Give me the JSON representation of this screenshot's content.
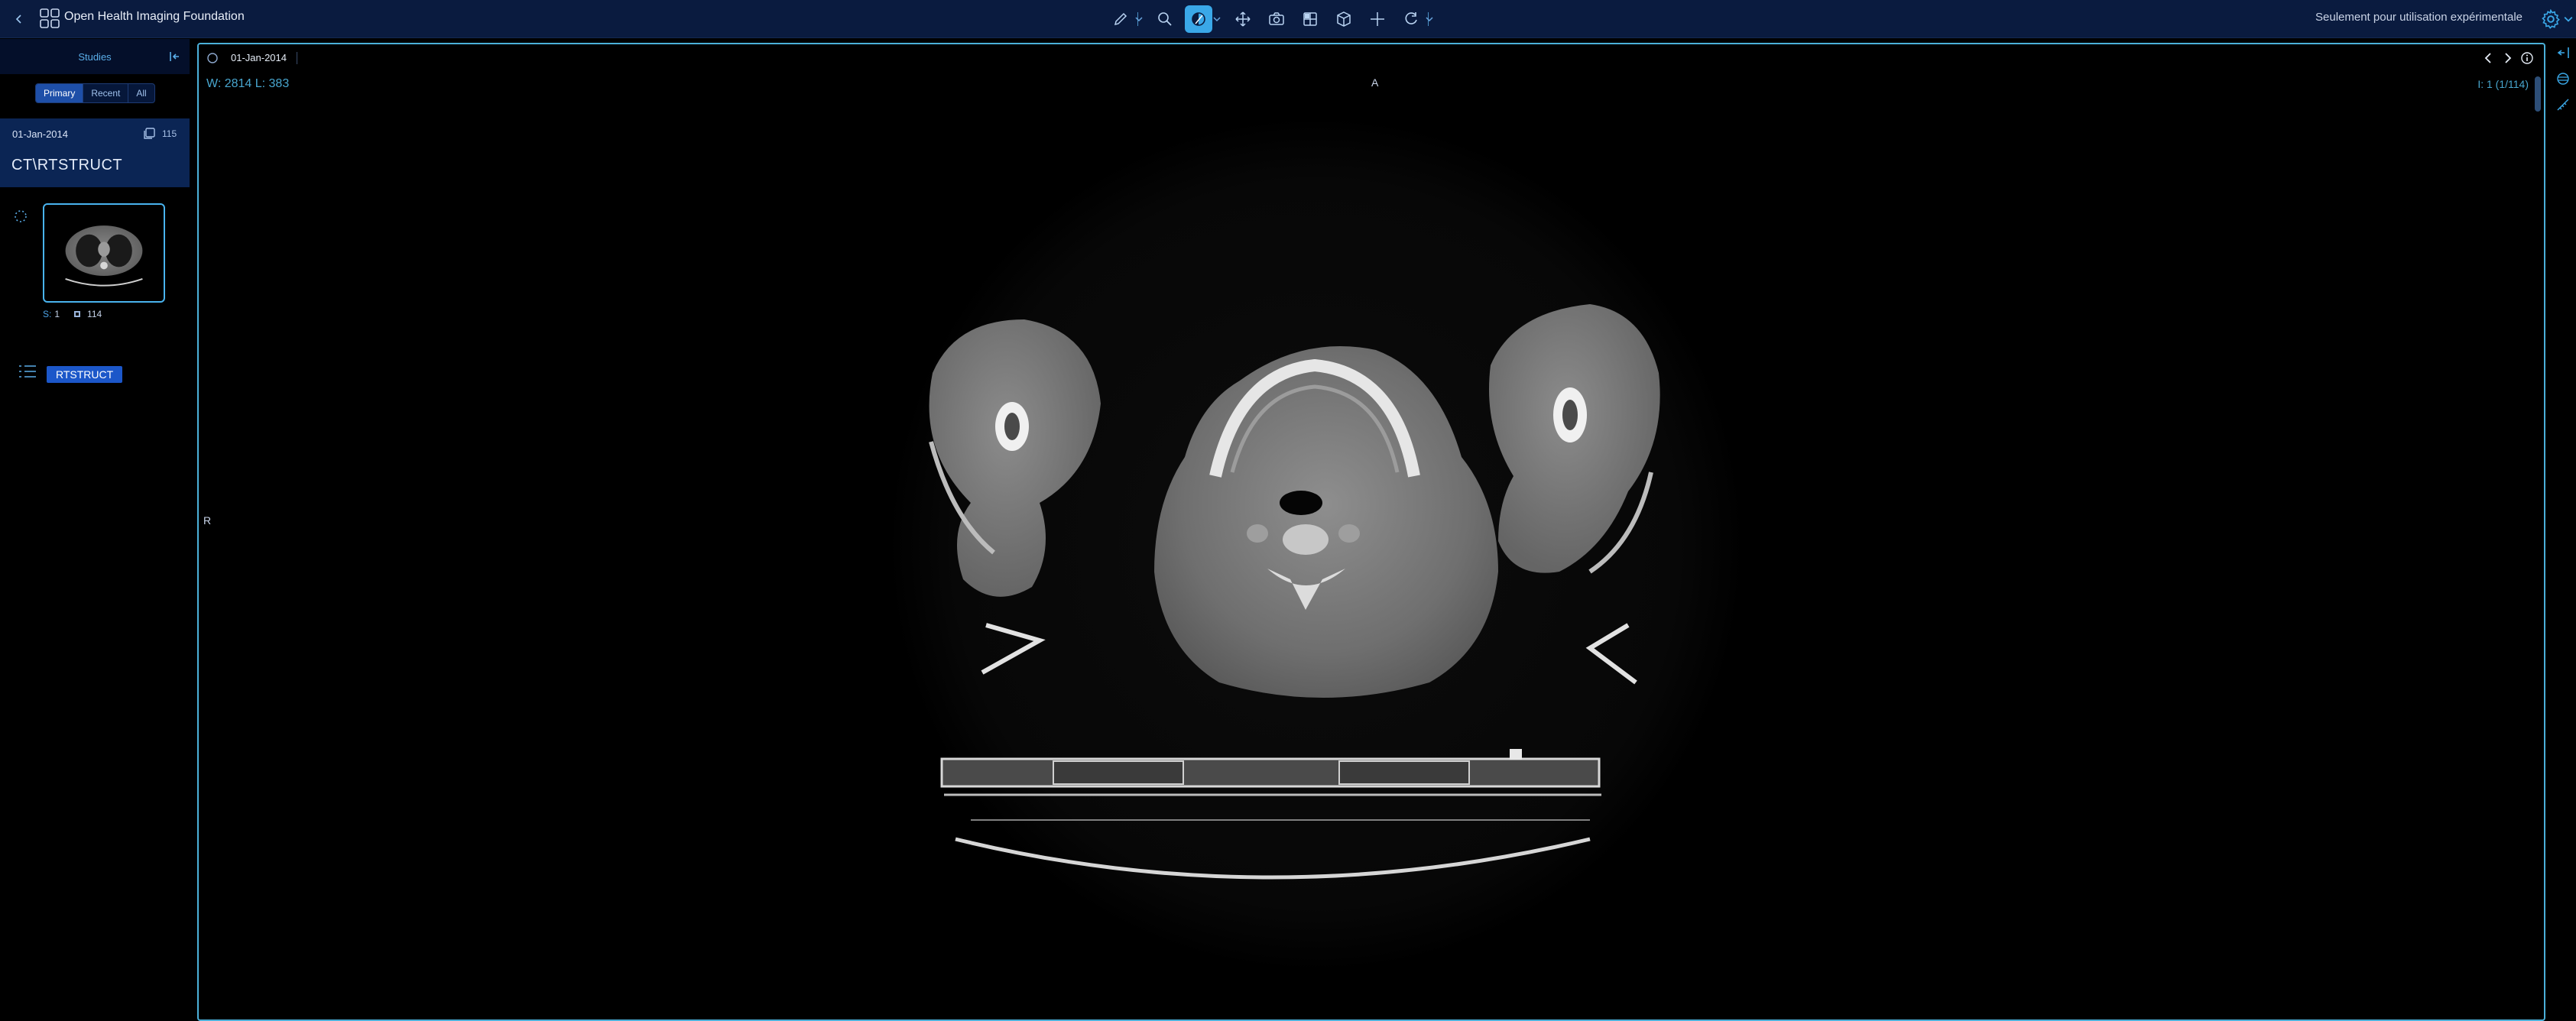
{
  "header": {
    "app_title": "Open Health Imaging Foundation",
    "experimental_notice": "Seulement pour utilisation expérimentale",
    "tools": [
      {
        "name": "pencil-icon",
        "has_menu": true
      },
      {
        "name": "zoom-icon",
        "has_menu": false
      },
      {
        "name": "window-level-icon",
        "has_menu": true,
        "active": true
      },
      {
        "name": "pan-icon",
        "has_menu": false
      },
      {
        "name": "capture-icon",
        "has_menu": false
      },
      {
        "name": "layout-icon",
        "has_menu": false
      },
      {
        "name": "cube-icon",
        "has_menu": false
      },
      {
        "name": "crosshairs-icon",
        "has_menu": false
      },
      {
        "name": "rotate-icon",
        "has_menu": true
      }
    ]
  },
  "left_panel": {
    "tab_label": "Studies",
    "filters": [
      "Primary",
      "Recent",
      "All"
    ],
    "active_filter": "Primary",
    "study": {
      "date": "01-Jan-2014",
      "instance_count": "115",
      "description": "CT\\RTSTRUCT"
    },
    "series": {
      "index_label": "S:",
      "index_value": "1",
      "image_count": "114"
    },
    "segmentation_label": "RTSTRUCT"
  },
  "viewport": {
    "study_date": "01-Jan-2014",
    "window_level": "W: 2814  L: 383",
    "orientation_top": "A",
    "orientation_left": "R",
    "image_index": "I: 1 (1/114)"
  },
  "colors": {
    "header_bg": "#0a1b3f",
    "accent": "#4bb0d9",
    "active_tool": "#3aa8e8",
    "badge": "#1c57c9"
  }
}
